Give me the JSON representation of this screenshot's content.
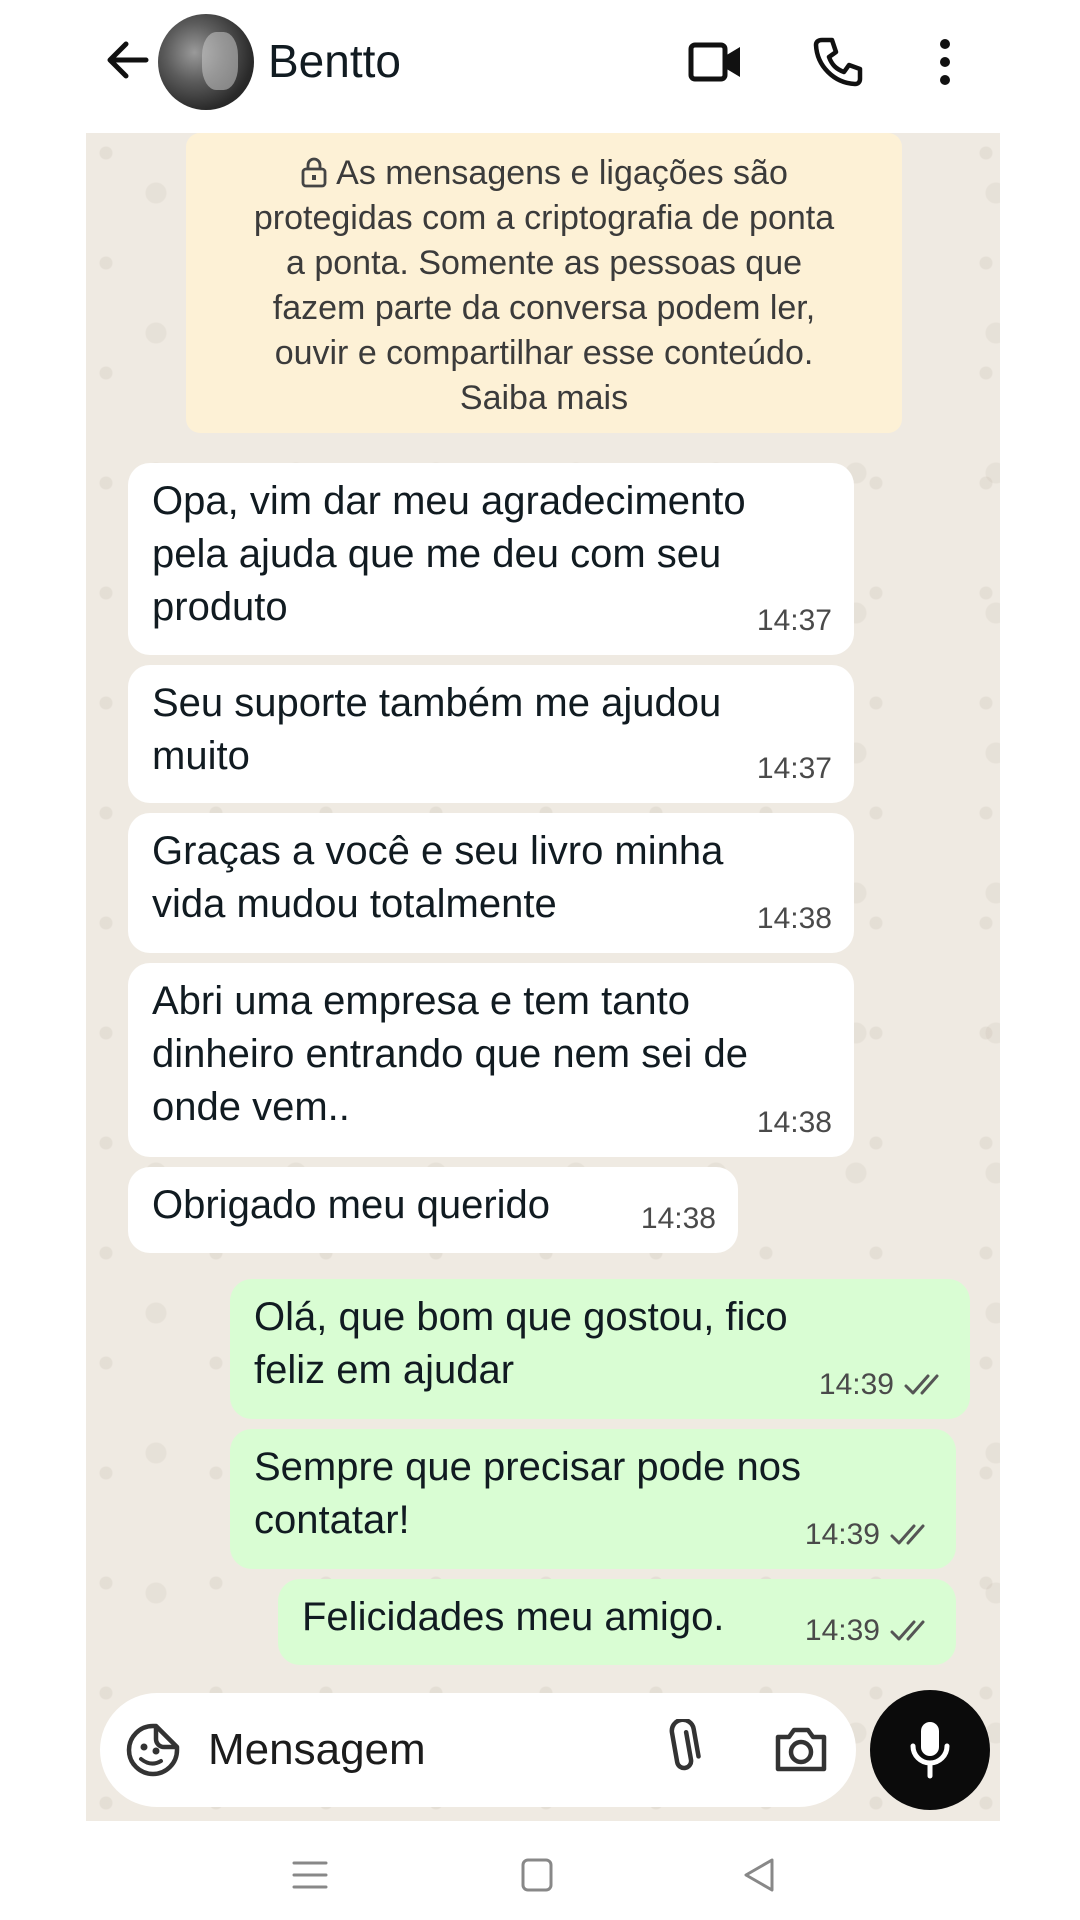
{
  "header": {
    "contact_name": "Bentto",
    "icons": [
      "arrow-left-icon",
      "video-camera-icon",
      "phone-icon",
      "more-vertical-icon"
    ]
  },
  "encryption_notice": {
    "lines": [
      "As mensagens e ligações são",
      "protegidas com a criptografia de ponta",
      "a ponta. Somente as pessoas que",
      "fazem parte da conversa podem ler,",
      "ouvir e compartilhar esse conteúdo.",
      "Saiba mais"
    ]
  },
  "messages": [
    {
      "direction": "incoming",
      "lines": [
        "Opa, vim dar meu agradecimento",
        "pela ajuda que me deu com seu",
        "produto"
      ],
      "time": "14:37"
    },
    {
      "direction": "incoming",
      "lines": [
        "Seu suporte também me ajudou",
        "muito"
      ],
      "time": "14:37"
    },
    {
      "direction": "incoming",
      "lines": [
        "Graças a você e seu livro minha",
        "vida mudou totalmente"
      ],
      "time": "14:38"
    },
    {
      "direction": "incoming",
      "lines": [
        "Abri uma empresa e tem tanto",
        "dinheiro entrando que nem sei de",
        "onde vem.."
      ],
      "time": "14:38"
    },
    {
      "direction": "incoming",
      "lines": [
        "Obrigado meu querido"
      ],
      "time": "14:38"
    },
    {
      "direction": "outgoing",
      "lines": [
        "Olá, que bom que gostou, fico",
        "feliz em ajudar"
      ],
      "time": "14:39",
      "status": "read"
    },
    {
      "direction": "outgoing",
      "lines": [
        "Sempre que precisar pode nos",
        "contatar!"
      ],
      "time": "14:39",
      "status": "read"
    },
    {
      "direction": "outgoing",
      "lines": [
        "Felicidades meu amigo."
      ],
      "time": "14:39",
      "status": "read"
    }
  ],
  "composer": {
    "placeholder": "Mensagem",
    "icons": [
      "sticker-icon",
      "paperclip-icon",
      "camera-icon",
      "microphone-icon"
    ]
  },
  "colors": {
    "incoming_bubble": "#ffffff",
    "outgoing_bubble": "#d9fdd3",
    "chat_background": "#efeae2",
    "encryption_notice_bg": "#fdf1d6",
    "mic_button": "#0b0b0b"
  }
}
